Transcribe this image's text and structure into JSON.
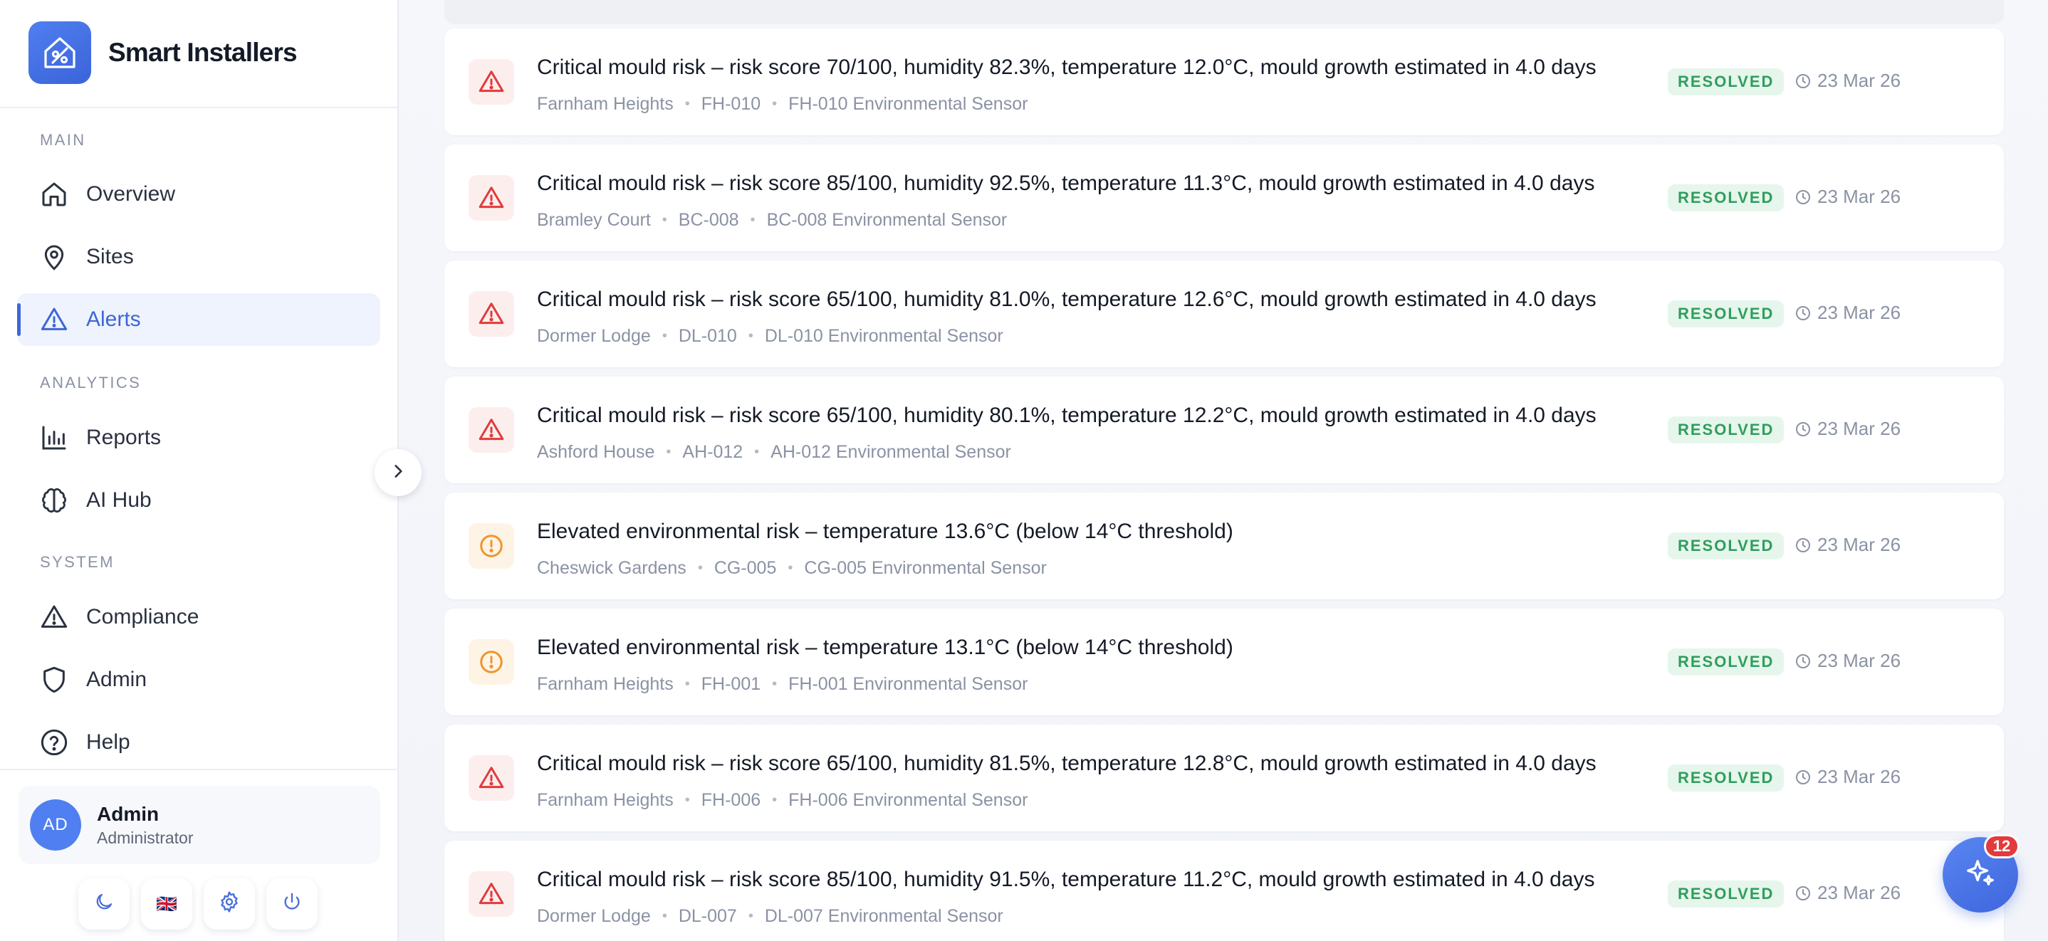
{
  "brand": {
    "name": "Smart Installers"
  },
  "sidebar": {
    "sections": {
      "main": "MAIN",
      "analytics": "ANALYTICS",
      "system": "SYSTEM"
    },
    "items": [
      {
        "label": "Overview",
        "icon": "home-icon",
        "active": false
      },
      {
        "label": "Sites",
        "icon": "map-pin-icon",
        "active": false
      },
      {
        "label": "Alerts",
        "icon": "alert-triangle-icon",
        "active": true
      },
      {
        "label": "Reports",
        "icon": "bar-chart-icon",
        "active": false
      },
      {
        "label": "AI Hub",
        "icon": "brain-icon",
        "active": false
      },
      {
        "label": "Compliance",
        "icon": "alert-triangle-icon",
        "active": false
      },
      {
        "label": "Admin",
        "icon": "shield-icon",
        "active": false
      },
      {
        "label": "Help",
        "icon": "help-circle-icon",
        "active": false
      }
    ],
    "user": {
      "initials": "AD",
      "name": "Admin",
      "role": "Administrator"
    },
    "footer": {
      "language_flag": "🇬🇧"
    }
  },
  "alerts": [
    {
      "severity": "critical",
      "title": "Critical mould risk – risk score 70/100, humidity 82.3%, temperature 12.0°C, mould growth estimated in 4.0 days",
      "site": "Farnham Heights",
      "unit": "FH-010",
      "device": "FH-010 Environmental Sensor",
      "status": "RESOLVED",
      "date": "23 Mar 26"
    },
    {
      "severity": "critical",
      "title": "Critical mould risk – risk score 85/100, humidity 92.5%, temperature 11.3°C, mould growth estimated in 4.0 days",
      "site": "Bramley Court",
      "unit": "BC-008",
      "device": "BC-008 Environmental Sensor",
      "status": "RESOLVED",
      "date": "23 Mar 26"
    },
    {
      "severity": "critical",
      "title": "Critical mould risk – risk score 65/100, humidity 81.0%, temperature 12.6°C, mould growth estimated in 4.0 days",
      "site": "Dormer Lodge",
      "unit": "DL-010",
      "device": "DL-010 Environmental Sensor",
      "status": "RESOLVED",
      "date": "23 Mar 26"
    },
    {
      "severity": "critical",
      "title": "Critical mould risk – risk score 65/100, humidity 80.1%, temperature 12.2°C, mould growth estimated in 4.0 days",
      "site": "Ashford House",
      "unit": "AH-012",
      "device": "AH-012 Environmental Sensor",
      "status": "RESOLVED",
      "date": "23 Mar 26"
    },
    {
      "severity": "warning",
      "title": "Elevated environmental risk – temperature 13.6°C (below 14°C threshold)",
      "site": "Cheswick Gardens",
      "unit": "CG-005",
      "device": "CG-005 Environmental Sensor",
      "status": "RESOLVED",
      "date": "23 Mar 26"
    },
    {
      "severity": "warning",
      "title": "Elevated environmental risk – temperature 13.1°C (below 14°C threshold)",
      "site": "Farnham Heights",
      "unit": "FH-001",
      "device": "FH-001 Environmental Sensor",
      "status": "RESOLVED",
      "date": "23 Mar 26"
    },
    {
      "severity": "critical",
      "title": "Critical mould risk – risk score 65/100, humidity 81.5%, temperature 12.8°C, mould growth estimated in 4.0 days",
      "site": "Farnham Heights",
      "unit": "FH-006",
      "device": "FH-006 Environmental Sensor",
      "status": "RESOLVED",
      "date": "23 Mar 26"
    },
    {
      "severity": "critical",
      "title": "Critical mould risk – risk score 85/100, humidity 91.5%, temperature 11.2°C, mould growth estimated in 4.0 days",
      "site": "Dormer Lodge",
      "unit": "DL-007",
      "device": "DL-007 Environmental Sensor",
      "status": "RESOLVED",
      "date": "23 Mar 26"
    }
  ],
  "assistant": {
    "badge_count": "12"
  },
  "colors": {
    "accent": "#3e66d6",
    "critical": "#e03b3b",
    "warning": "#f0952c",
    "resolved_bg": "#e6f6ec",
    "resolved_text": "#2f9e5c"
  }
}
